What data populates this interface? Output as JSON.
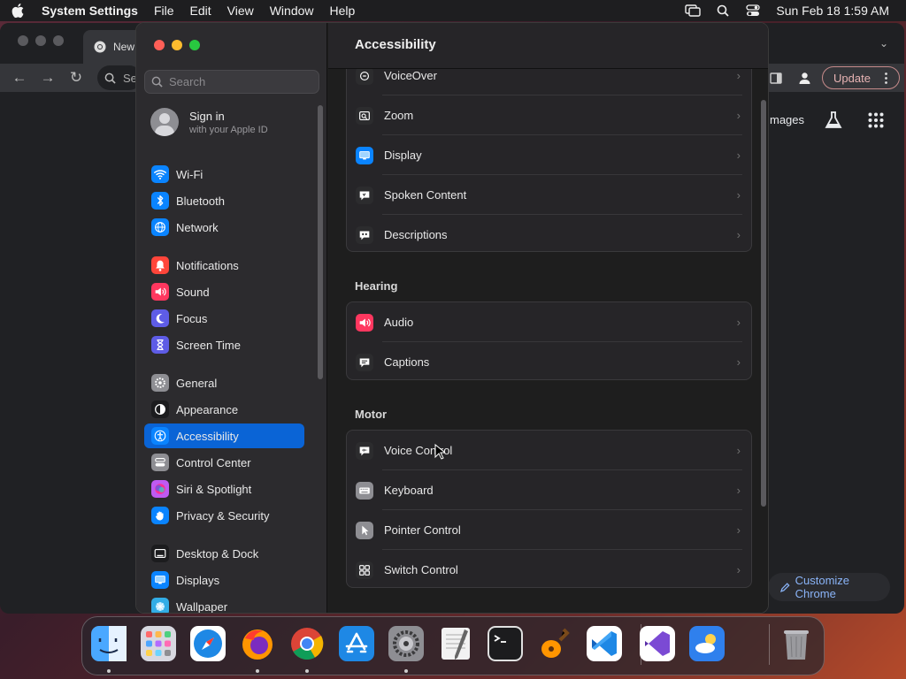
{
  "menubar": {
    "app_name": "System Settings",
    "menus": [
      "File",
      "Edit",
      "View",
      "Window",
      "Help"
    ],
    "datetime": "Sun Feb 18  1:59 AM"
  },
  "chrome": {
    "tab_label": "New",
    "omnibox_text": "Se",
    "update_label": "Update",
    "images_link": "mages",
    "customize_label": "Customize Chrome"
  },
  "settings": {
    "search_placeholder": "Search",
    "signin_title": "Sign in",
    "signin_subtitle": "with your Apple ID",
    "sidebar_items": [
      {
        "label": "Wi-Fi",
        "icon": "wifi-icon",
        "color": "#0a84ff"
      },
      {
        "label": "Bluetooth",
        "icon": "bluetooth-icon",
        "color": "#0a84ff"
      },
      {
        "label": "Network",
        "icon": "globe-icon",
        "color": "#0a84ff"
      },
      {
        "label": "Notifications",
        "icon": "bell-icon",
        "color": "#ff453a"
      },
      {
        "label": "Sound",
        "icon": "speaker-icon",
        "color": "#ff375f"
      },
      {
        "label": "Focus",
        "icon": "moon-icon",
        "color": "#5e5ce6"
      },
      {
        "label": "Screen Time",
        "icon": "hourglass-icon",
        "color": "#5e5ce6"
      },
      {
        "label": "General",
        "icon": "gear-icon",
        "color": "#8e8e93"
      },
      {
        "label": "Appearance",
        "icon": "appearance-icon",
        "color": "#1c1c1e"
      },
      {
        "label": "Accessibility",
        "icon": "accessibility-icon",
        "color": "#0a84ff",
        "selected": true
      },
      {
        "label": "Control Center",
        "icon": "control-center-icon",
        "color": "#8e8e93"
      },
      {
        "label": "Siri & Spotlight",
        "icon": "siri-icon",
        "color": "#bf5af2"
      },
      {
        "label": "Privacy & Security",
        "icon": "hand-icon",
        "color": "#0a84ff"
      },
      {
        "label": "Desktop & Dock",
        "icon": "dock-icon",
        "color": "#1c1c1e"
      },
      {
        "label": "Displays",
        "icon": "display-icon",
        "color": "#0a84ff"
      },
      {
        "label": "Wallpaper",
        "icon": "wallpaper-icon",
        "color": "#32ade6"
      }
    ],
    "page_title": "Accessibility",
    "vision_rows": [
      {
        "label": "VoiceOver",
        "icon": "voiceover-icon",
        "color": "#2c2c2e"
      },
      {
        "label": "Zoom",
        "icon": "zoom-icon",
        "color": "#2c2c2e"
      },
      {
        "label": "Display",
        "icon": "display-icon",
        "color": "#0a84ff"
      },
      {
        "label": "Spoken Content",
        "icon": "spoken-content-icon",
        "color": "#2c2c2e"
      },
      {
        "label": "Descriptions",
        "icon": "descriptions-icon",
        "color": "#2c2c2e"
      }
    ],
    "hearing_title": "Hearing",
    "hearing_rows": [
      {
        "label": "Audio",
        "icon": "speaker-icon",
        "color": "#ff375f"
      },
      {
        "label": "Captions",
        "icon": "captions-icon",
        "color": "#2c2c2e"
      }
    ],
    "motor_title": "Motor",
    "motor_rows": [
      {
        "label": "Voice Control",
        "icon": "voice-control-icon",
        "color": "#2c2c2e"
      },
      {
        "label": "Keyboard",
        "icon": "keyboard-icon",
        "color": "#8e8e93"
      },
      {
        "label": "Pointer Control",
        "icon": "pointer-icon",
        "color": "#8e8e93"
      },
      {
        "label": "Switch Control",
        "icon": "switch-control-icon",
        "color": "#2c2c2e"
      }
    ]
  },
  "dock": {
    "apps": [
      {
        "name": "finder-icon",
        "color": "#1e90ff",
        "running": true
      },
      {
        "name": "launchpad-icon",
        "color": "#d0d0d8",
        "running": false
      },
      {
        "name": "safari-icon",
        "color": "#1e88e5",
        "running": false
      },
      {
        "name": "firefox-icon",
        "color": "#7b2cbf",
        "running": true
      },
      {
        "name": "chrome-icon",
        "color": "#ffffff",
        "running": true
      },
      {
        "name": "app-store-icon",
        "color": "#1e88e5",
        "running": false
      },
      {
        "name": "system-settings-icon",
        "color": "#8e8e93",
        "running": true
      },
      {
        "name": "textedit-icon",
        "color": "#f2f2f2",
        "running": false
      },
      {
        "name": "terminal-icon",
        "color": "#1c1c1e",
        "running": false
      },
      {
        "name": "garageband-icon",
        "color": "#ff9500",
        "running": false
      },
      {
        "name": "vscode-icon",
        "color": "#ffffff",
        "running": false
      },
      {
        "name": "visual-studio-icon",
        "color": "#ffffff",
        "running": false
      },
      {
        "name": "weather-icon",
        "color": "#2f80ed",
        "running": false
      },
      {
        "name": "trash-icon",
        "color": "#9a9a9e",
        "running": false
      }
    ]
  }
}
